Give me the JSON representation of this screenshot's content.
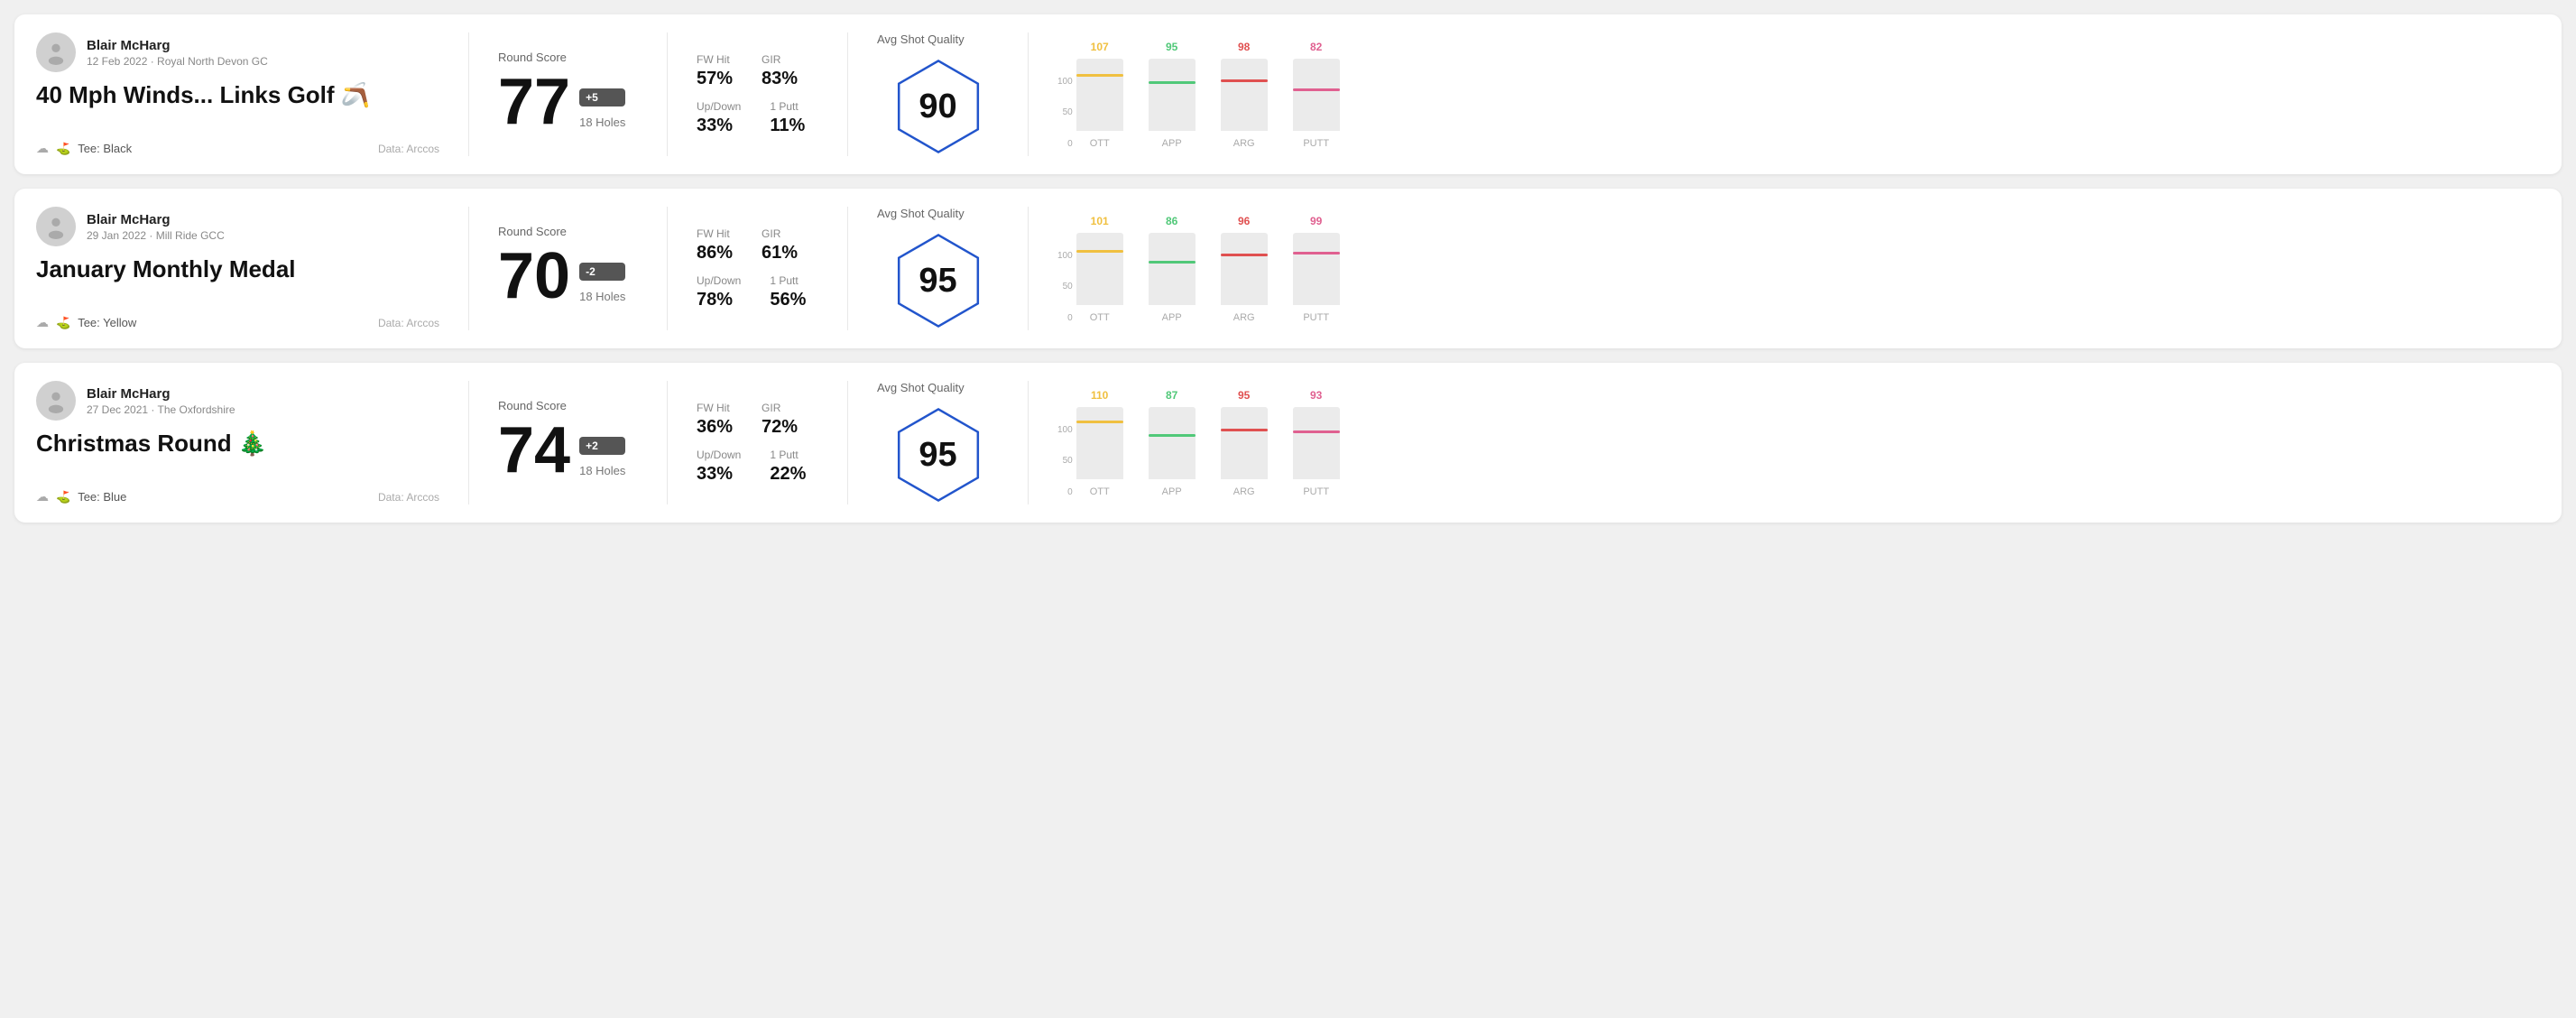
{
  "rounds": [
    {
      "id": "round1",
      "user": {
        "name": "Blair McHarg",
        "date_course": "12 Feb 2022 · Royal North Devon GC"
      },
      "title": "40 Mph Winds... Links Golf 🪃",
      "tee": "Tee: Black",
      "data_source": "Data: Arccos",
      "score": "77",
      "score_badge": "+5",
      "holes": "18 Holes",
      "fw_hit": "57%",
      "gir": "83%",
      "up_down": "33%",
      "one_putt": "11%",
      "avg_shot_quality_label": "Avg Shot Quality",
      "quality_score": "90",
      "chart": {
        "ott": {
          "value": 107,
          "color": "#f0c040",
          "bar_pct": 75
        },
        "app": {
          "value": 95,
          "color": "#50c878",
          "bar_pct": 65
        },
        "arg": {
          "value": 98,
          "color": "#e05050",
          "bar_pct": 68
        },
        "putt": {
          "value": 82,
          "color": "#e06090",
          "bar_pct": 55
        }
      }
    },
    {
      "id": "round2",
      "user": {
        "name": "Blair McHarg",
        "date_course": "29 Jan 2022 · Mill Ride GCC"
      },
      "title": "January Monthly Medal",
      "tee": "Tee: Yellow",
      "data_source": "Data: Arccos",
      "score": "70",
      "score_badge": "-2",
      "holes": "18 Holes",
      "fw_hit": "86%",
      "gir": "61%",
      "up_down": "78%",
      "one_putt": "56%",
      "avg_shot_quality_label": "Avg Shot Quality",
      "quality_score": "95",
      "chart": {
        "ott": {
          "value": 101,
          "color": "#f0c040",
          "bar_pct": 72
        },
        "app": {
          "value": 86,
          "color": "#50c878",
          "bar_pct": 58
        },
        "arg": {
          "value": 96,
          "color": "#e05050",
          "bar_pct": 67
        },
        "putt": {
          "value": 99,
          "color": "#e06090",
          "bar_pct": 70
        }
      }
    },
    {
      "id": "round3",
      "user": {
        "name": "Blair McHarg",
        "date_course": "27 Dec 2021 · The Oxfordshire"
      },
      "title": "Christmas Round 🎄",
      "tee": "Tee: Blue",
      "data_source": "Data: Arccos",
      "score": "74",
      "score_badge": "+2",
      "holes": "18 Holes",
      "fw_hit": "36%",
      "gir": "72%",
      "up_down": "33%",
      "one_putt": "22%",
      "avg_shot_quality_label": "Avg Shot Quality",
      "quality_score": "95",
      "chart": {
        "ott": {
          "value": 110,
          "color": "#f0c040",
          "bar_pct": 78
        },
        "app": {
          "value": 87,
          "color": "#50c878",
          "bar_pct": 59
        },
        "arg": {
          "value": 95,
          "color": "#e05050",
          "bar_pct": 66
        },
        "putt": {
          "value": 93,
          "color": "#e06090",
          "bar_pct": 64
        }
      }
    }
  ],
  "chart_axis": {
    "y_labels": [
      "100",
      "50",
      "0"
    ],
    "x_labels": [
      "OTT",
      "APP",
      "ARG",
      "PUTT"
    ]
  }
}
